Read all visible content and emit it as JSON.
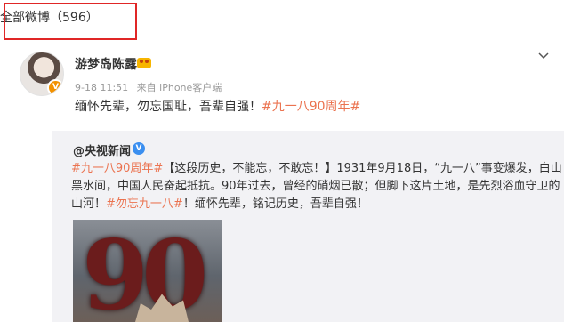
{
  "header": {
    "title": "全部微博（596）"
  },
  "post": {
    "author": "游梦岛陈露",
    "time": "9-18 11:51",
    "source": "来自 iPhone客户端",
    "text_prefix": "缅怀先辈，勿忘国耻，吾辈自强！",
    "topic": "#九一八90周年#"
  },
  "repost": {
    "author": "@央视新闻",
    "topic": "#九一八90周年#",
    "text_rest": "【这段历史，不能忘，不敢忘！】1931年9月18日，“九一八”事变爆发，白山黑水间，中国人民奋起抵抗。90年过去，曾经的硝烟已散；但脚下这片土地，是先烈浴血守卫的山河！",
    "topic2": "#勿忘九一八#",
    "text_tail": "！缅怀先辈，铭记历史，吾辈自强！",
    "image_text": "90"
  },
  "icons": {
    "verified": "V",
    "chevron": "chevron-down-icon"
  },
  "colors": {
    "highlight": "#e02626",
    "topic": "#eb7350",
    "repost_bg": "#f2f2f5"
  }
}
